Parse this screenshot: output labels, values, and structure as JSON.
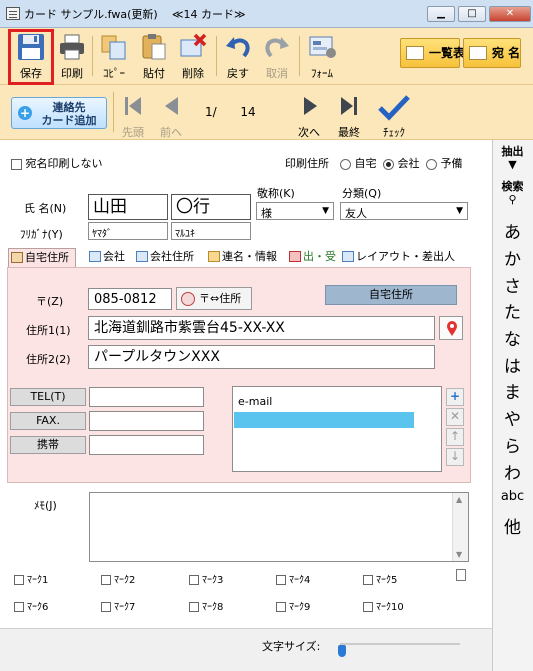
{
  "window": {
    "title": "カード サンプル.fwa(更新)",
    "count": "≪14 カード≫",
    "buttons": {
      "minimize": "▁",
      "maximize": "□",
      "close": "✕"
    }
  },
  "toolbar1": {
    "save": "保存",
    "print": "印刷",
    "copy": "ｺﾋﾟｰ",
    "paste": "貼付",
    "delete": "削除",
    "undo": "戻す",
    "redo": "取消",
    "form": "ﾌｫｰﾑ",
    "list": "一覧表",
    "addressee": "宛 名"
  },
  "toolbar2": {
    "add_card_line1": "連絡先",
    "add_card_line2": "カード追加",
    "first": "先頭",
    "prev": "前へ",
    "next": "次へ",
    "last": "最終",
    "check": "ﾁｪｯｸ",
    "page_current": "1/",
    "page_total": "14"
  },
  "sidebar": {
    "extract": "抽出",
    "search": "検索",
    "kana": [
      "あ",
      "か",
      "さ",
      "た",
      "な",
      "は",
      "ま",
      "や",
      "ら",
      "わ"
    ],
    "abc": "abc",
    "other": "他"
  },
  "form": {
    "no_print_label": "宛名印刷しない",
    "print_address_label": "印刷住所",
    "print_address_options": [
      "自宅",
      "会社",
      "予備"
    ],
    "print_address_selected": "会社",
    "name_label": "氏 名(N)",
    "kana_label": "ﾌﾘｶﾞﾅ(Y)",
    "last_name": "山田",
    "first_name": "〇行",
    "last_kana": "ﾔﾏﾀﾞ",
    "first_kana": "ﾏﾙﾕｷ",
    "honorific_label": "敬称(K)",
    "honorific_value": "様",
    "category_label": "分類(Q)",
    "category_value": "友人",
    "tabs": [
      "自宅住所",
      "会社",
      "会社住所",
      "連名・情報",
      "出・受",
      "レイアウト・差出人"
    ],
    "zip_label": "〒(Z)",
    "zip_value": "085-0812",
    "zip_convert_button": "〒⇔住所",
    "address_type": "自宅住所",
    "address1_label": "住所1(1)",
    "address1_value": "北海道釧路市紫雲台45-XX-XX",
    "address2_label": "住所2(2)",
    "address2_value": "パープルタウンXXX",
    "tel_label": "TEL(T)",
    "fax_label": "FAX.",
    "mobile_label": "携帯",
    "email_header": "e-mail",
    "memo_label": "ﾒﾓ(J)",
    "marks": [
      "ﾏｰｸ1",
      "ﾏｰｸ2",
      "ﾏｰｸ3",
      "ﾏｰｸ4",
      "ﾏｰｸ5",
      "ﾏｰｸ6",
      "ﾏｰｸ7",
      "ﾏｰｸ8",
      "ﾏｰｸ9",
      "ﾏｰｸ10"
    ],
    "font_size_label": "文字サイズ:"
  }
}
